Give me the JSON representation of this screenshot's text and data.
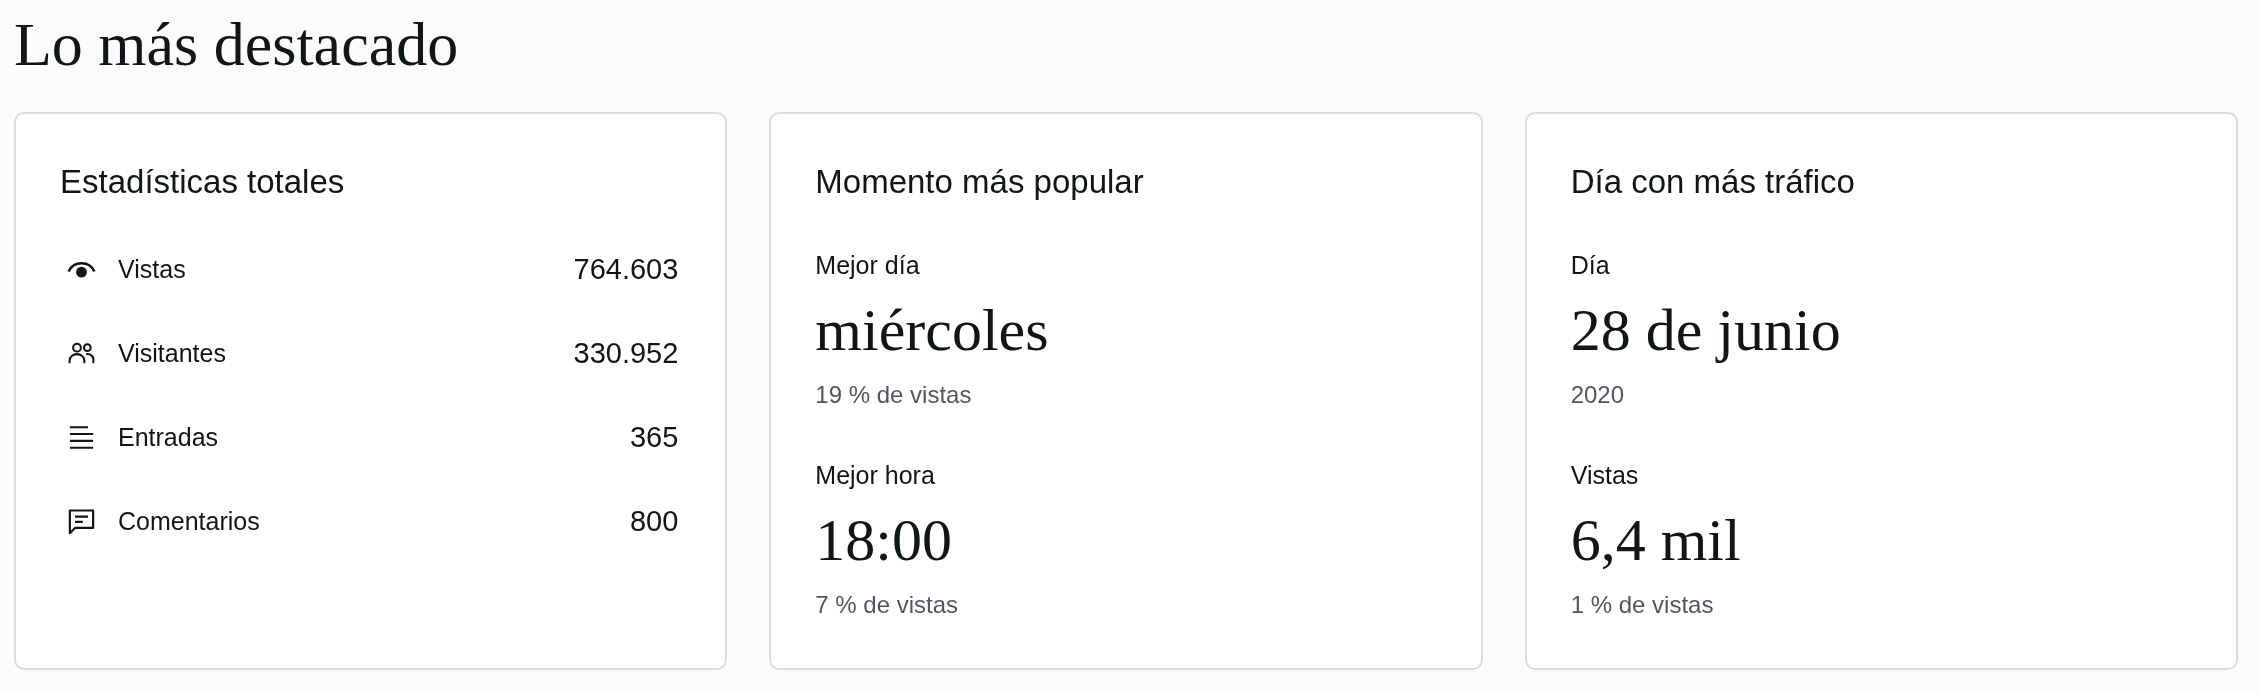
{
  "page": {
    "title": "Lo más destacado"
  },
  "cards": [
    {
      "kind": "list",
      "title": "Estadísticas totales",
      "rows": [
        {
          "kind": "views",
          "label": "Vistas",
          "value": "764.603"
        },
        {
          "kind": "visitors",
          "label": "Visitantes",
          "value": "330.952"
        },
        {
          "kind": "posts",
          "label": "Entradas",
          "value": "365"
        },
        {
          "kind": "comments",
          "label": "Comentarios",
          "value": "800"
        }
      ]
    },
    {
      "kind": "highlights",
      "title": "Momento más popular",
      "stats": [
        {
          "label": "Mejor día",
          "value": "miércoles",
          "note": "19 % de vistas"
        },
        {
          "label": "Mejor hora",
          "value": "18:00",
          "note": "7 % de vistas"
        }
      ]
    },
    {
      "kind": "highlights",
      "title": "Día con más tráfico",
      "stats": [
        {
          "label": "Día",
          "value": "28 de junio",
          "note": "2020"
        },
        {
          "label": "Vistas",
          "value": "6,4 mil",
          "note": "1 % de vistas"
        }
      ]
    }
  ]
}
